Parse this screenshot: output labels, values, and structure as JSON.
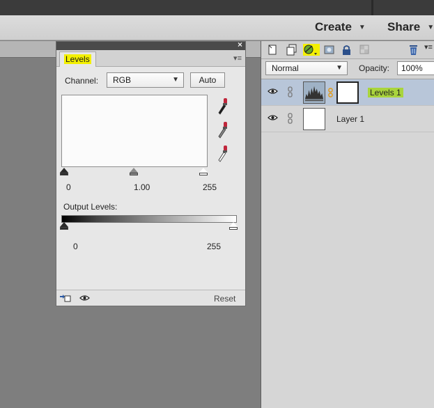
{
  "header": {
    "create_label": "Create",
    "share_label": "Share"
  },
  "levels_panel": {
    "tab_label": "Levels",
    "channel_label": "Channel:",
    "channel_value": "RGB",
    "auto_label": "Auto",
    "input_black": "0",
    "input_gamma": "1.00",
    "input_white": "255",
    "output_label": "Output Levels:",
    "output_black": "0",
    "output_white": "255",
    "reset_label": "Reset"
  },
  "layers_panel": {
    "blend_mode": "Normal",
    "opacity_label": "Opacity:",
    "opacity_value": "100%",
    "layers": [
      {
        "name": "Levels 1",
        "selected": true
      },
      {
        "name": "Layer 1",
        "selected": false
      }
    ]
  },
  "colors": {
    "tab_highlight": "#f3f000",
    "layer_highlight": "#a9d43d",
    "selection": "#b8c6d9"
  }
}
